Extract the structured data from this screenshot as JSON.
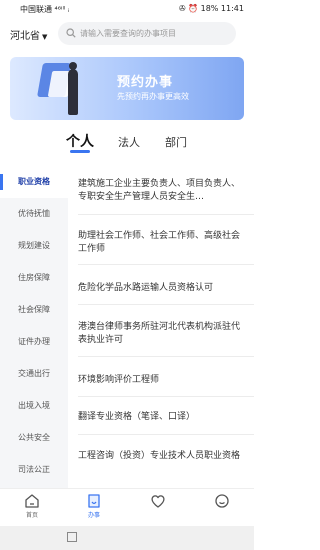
{
  "status": {
    "carrier": "中国联通 ⁴⁶ᴵˡˡ ᵢ",
    "right_text": "✇ ⏰ 18% 11:41"
  },
  "search": {
    "province": "河北省",
    "placeholder": "请输入需要查询的办事项目"
  },
  "banner": {
    "title": "预约办事",
    "subtitle": "先预约再办事更高效"
  },
  "tabs": [
    "个人",
    "法人",
    "部门"
  ],
  "categories": [
    "职业资格",
    "优待抚恤",
    "规划建设",
    "住房保障",
    "社会保障",
    "证件办理",
    "交通出行",
    "出境入境",
    "公共安全",
    "司法公正"
  ],
  "items": [
    "建筑施工企业主要负责人、项目负责人、专职安全生产管理人员安全生…",
    "助理社会工作师、社会工作师、高级社会工作师",
    "危险化学品水路运输人员资格认可",
    "港澳台律师事务所驻河北代表机构派驻代表执业许可",
    "环境影响评价工程师",
    "翻译专业资格（笔译、口译）",
    "工程咨询（投资）专业技术人员职业资格"
  ],
  "bottom_nav": [
    {
      "label": "首页",
      "icon": "home-icon"
    },
    {
      "label": "办事",
      "icon": "document-icon"
    },
    {
      "label": "",
      "icon": "heart-icon"
    },
    {
      "label": "",
      "icon": "user-icon"
    }
  ],
  "colors": {
    "accent": "#3a75f0",
    "active_category": "#1f3fa8"
  }
}
